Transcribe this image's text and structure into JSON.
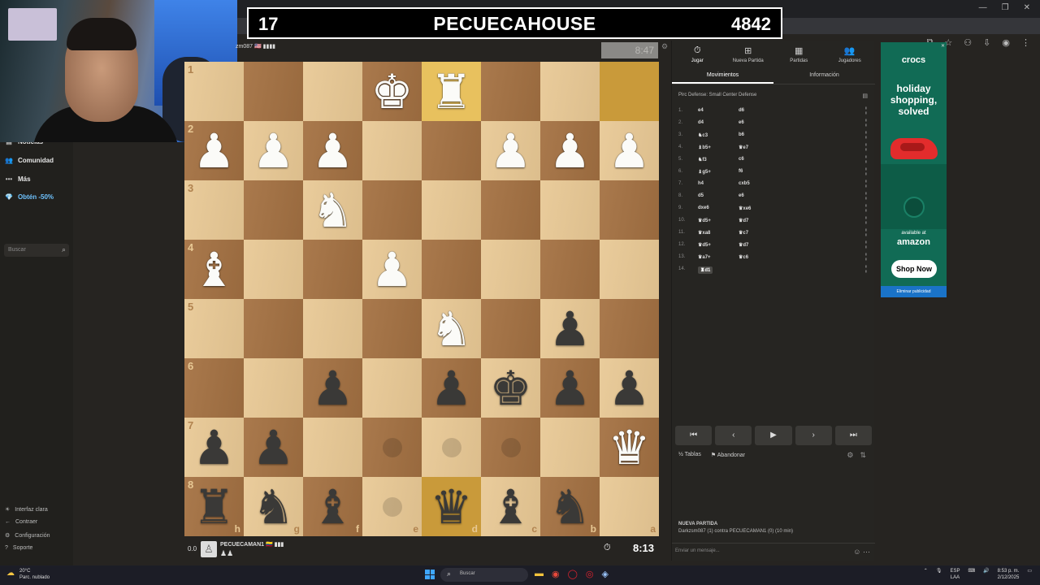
{
  "banner": {
    "left_number": "17",
    "title": "PECUECAHOUSE",
    "right_number": "4842"
  },
  "opponent": {
    "name": "zm087 🇺🇸 ▮▮▮▮",
    "clock": "8:47"
  },
  "player": {
    "eval": "0.0",
    "name": "PECUECAMAN1 🇨🇴 ▮▮▮",
    "captured": "♟♟",
    "clock": "8:13"
  },
  "sidebar": {
    "items": [
      {
        "icon": "▤",
        "label": "Noticias"
      },
      {
        "icon": "👥",
        "label": "Comunidad"
      },
      {
        "icon": "•••",
        "label": "Más"
      },
      {
        "icon": "💎",
        "label": "Obtén -50%"
      }
    ],
    "search_placeholder": "Buscar",
    "bottom_items": [
      {
        "icon": "☀",
        "label": "Interfaz clara"
      },
      {
        "icon": "←",
        "label": "Contraer"
      },
      {
        "icon": "⚙",
        "label": "Configuración"
      },
      {
        "icon": "?",
        "label": "Soporte"
      }
    ]
  },
  "board": {
    "rows": [
      [
        "",
        "",
        "",
        "K",
        "R",
        "",
        "",
        ""
      ],
      [
        "P",
        "P",
        "P",
        "",
        "",
        "P",
        "P",
        "P"
      ],
      [
        "",
        "",
        "N",
        "",
        "",
        "",
        "",
        ""
      ],
      [
        "B",
        "",
        "",
        "P",
        "",
        "",
        "",
        ""
      ],
      [
        "",
        "",
        "",
        "",
        "N",
        "",
        "p",
        ""
      ],
      [
        "",
        "",
        "p",
        "",
        "p",
        "k",
        "p",
        "p"
      ],
      [
        "p",
        "p",
        "",
        "",
        "",
        "",
        "",
        "Q"
      ],
      [
        "r",
        "n",
        "b",
        "",
        "q",
        "b",
        "n",
        ""
      ]
    ],
    "rank_labels": [
      "1",
      "2",
      "3",
      "4",
      "5",
      "6",
      "7",
      "8"
    ],
    "file_labels": [
      "h",
      "g",
      "f",
      "e",
      "d",
      "c",
      "b",
      "a"
    ],
    "highlights": [
      [
        0,
        7
      ],
      [
        0,
        4
      ],
      [
        7,
        4
      ]
    ],
    "dots": [
      [
        6,
        3
      ],
      [
        6,
        4
      ],
      [
        6,
        5
      ],
      [
        7,
        3
      ]
    ]
  },
  "panel": {
    "tabs": [
      {
        "icon": "⏱",
        "label": "Jugar"
      },
      {
        "icon": "⊞",
        "label": "Nueva Partida"
      },
      {
        "icon": "▦",
        "label": "Partidas"
      },
      {
        "icon": "👥",
        "label": "Jugadores"
      }
    ],
    "subtabs": [
      "Movimientos",
      "Información"
    ],
    "opening": "Pirc Defense: Small Center Defense",
    "moves": [
      {
        "num": "1.",
        "white": "e4",
        "black": "d6"
      },
      {
        "num": "2.",
        "white": "d4",
        "black": "e6"
      },
      {
        "num": "3.",
        "white": "♞c3",
        "black": "b6"
      },
      {
        "num": "4.",
        "white": "♝b5+",
        "black": "♛e7"
      },
      {
        "num": "5.",
        "white": "♞f3",
        "black": "c6"
      },
      {
        "num": "6.",
        "white": "♝g5+",
        "black": "f6"
      },
      {
        "num": "7.",
        "white": "h4",
        "black": "cxb5"
      },
      {
        "num": "8.",
        "white": "d5",
        "black": "e6"
      },
      {
        "num": "9.",
        "white": "dxe6",
        "black": "♛xe6"
      },
      {
        "num": "10.",
        "white": "♛d5+",
        "black": "♛d7"
      },
      {
        "num": "11.",
        "white": "♛xa8",
        "black": "♛c7"
      },
      {
        "num": "12.",
        "white": "♛d5+",
        "black": "♛d7"
      },
      {
        "num": "13.",
        "white": "♛a7+",
        "black": "♛c6"
      },
      {
        "num": "14.",
        "white": "♜d1",
        "black": ""
      }
    ],
    "nav": [
      "⏮",
      "‹",
      "▶",
      "›",
      "⏭"
    ],
    "draw_label": "Tablas",
    "resign_label": "Abandonar",
    "new_game_title": "NUEVA PARTIDA",
    "new_game_desc": "Darkzsm087 (1) contra PECUECAMAN1 (0) (10 min)",
    "chat_placeholder": "Enviar un mensaje..."
  },
  "ad": {
    "brand": "crocs",
    "headline": "holiday shopping, solved",
    "available": "available at",
    "store": "amazon",
    "cta": "Shop Now",
    "remove": "Eliminar publicidad"
  },
  "taskbar": {
    "weather_temp": "20°C",
    "weather_desc": "Parc. nublado",
    "search_placeholder": "Buscar",
    "lang": "ESP",
    "lang2": "LAA",
    "time": "8:53 p. m.",
    "date": "2/12/2025"
  },
  "colors": {
    "light_square": "#e8c894",
    "dark_square": "#a57243",
    "highlight": "#e8c15e",
    "ad_bg": "#116b55"
  }
}
